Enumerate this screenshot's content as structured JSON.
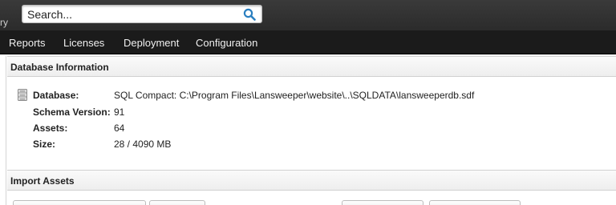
{
  "topbar": {
    "partial_text": "ry",
    "search_placeholder": "Search..."
  },
  "menu": {
    "items": [
      {
        "label": "Reports"
      },
      {
        "label": "Licenses"
      },
      {
        "label": "Deployment"
      },
      {
        "label": "Configuration"
      }
    ]
  },
  "database_information": {
    "title": "Database Information",
    "rows": [
      {
        "label": "Database:",
        "value": "SQL Compact: C:\\Program Files\\Lansweeper\\website\\..\\SQLDATA\\lansweeperdb.sdf"
      },
      {
        "label": "Schema Version:",
        "value": "91"
      },
      {
        "label": "Assets:",
        "value": "64"
      },
      {
        "label": "Size:",
        "value": "28 / 4090 MB"
      }
    ]
  },
  "import_assets": {
    "title": "Import Assets"
  },
  "colors": {
    "topbar": "#2f2f2f",
    "menubar": "#1b1b1b",
    "search_icon": "#2a7fc0"
  },
  "icons": {
    "search": "search-icon",
    "database": "database-icon"
  }
}
